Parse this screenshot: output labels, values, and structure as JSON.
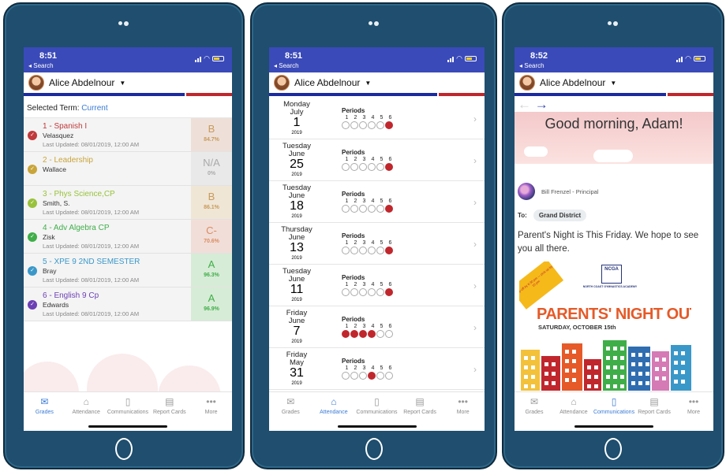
{
  "screens": [
    {
      "status_time": "8:51",
      "back_label": "◂ Search",
      "user_name": "Alice Abdelnour",
      "term_label": "Selected Term:",
      "term_value": "Current",
      "courses": [
        {
          "name": "1 - Spanish I",
          "teacher": "Velasquez",
          "updated": "Last Updated: 08/01/2019, 12:00 AM",
          "grade": "B",
          "pct": "84.7%",
          "accent": "#c0393b",
          "bg": "#eee0d9",
          "fg": "#c99a5a"
        },
        {
          "name": "2 - Leadership",
          "teacher": "Wallace",
          "updated": "",
          "grade": "N/A",
          "pct": "0%",
          "accent": "#c9a53a",
          "bg": "#e9e9e9",
          "fg": "#aaaaaa"
        },
        {
          "name": "3 - Phys Science,CP",
          "teacher": "Smith, S.",
          "updated": "Last Updated: 08/01/2019, 12:00 AM",
          "grade": "B",
          "pct": "86.1%",
          "accent": "#98c23a",
          "bg": "#efe6d6",
          "fg": "#c99a5a"
        },
        {
          "name": "4 - Adv Algebra CP",
          "teacher": "Zisk",
          "updated": "Last Updated: 08/01/2019, 12:00 AM",
          "grade": "C-",
          "pct": "70.6%",
          "accent": "#3fae49",
          "bg": "#f2ded8",
          "fg": "#d88c62"
        },
        {
          "name": "5 - XPE 9 2ND SEMESTER",
          "teacher": "Bray",
          "updated": "Last Updated: 08/01/2019, 12:00 AM",
          "grade": "A",
          "pct": "96.3%",
          "accent": "#3a98c9",
          "bg": "#d7ecd6",
          "fg": "#3fae49"
        },
        {
          "name": "6 - English 9 Cp",
          "teacher": "Edwards",
          "updated": "Last Updated: 08/01/2019, 12:00 AM",
          "grade": "A",
          "pct": "96.9%",
          "accent": "#6b3fb5",
          "bg": "#d7ecd6",
          "fg": "#3fae49"
        }
      ]
    },
    {
      "status_time": "8:51",
      "back_label": "◂ Search",
      "user_name": "Alice Abdelnour",
      "periods_label": "Periods",
      "period_numbers": [
        "1",
        "2",
        "3",
        "4",
        "5",
        "6"
      ],
      "days": [
        {
          "dow": "Monday",
          "month": "July",
          "day": "1",
          "year": "2019",
          "absent": [
            6
          ]
        },
        {
          "dow": "Tuesday",
          "month": "June",
          "day": "25",
          "year": "2019",
          "absent": [
            6
          ]
        },
        {
          "dow": "Tuesday",
          "month": "June",
          "day": "18",
          "year": "2019",
          "absent": [
            6
          ]
        },
        {
          "dow": "Thursday",
          "month": "June",
          "day": "13",
          "year": "2019",
          "absent": [
            6
          ]
        },
        {
          "dow": "Tuesday",
          "month": "June",
          "day": "11",
          "year": "2019",
          "absent": [
            6
          ]
        },
        {
          "dow": "Friday",
          "month": "June",
          "day": "7",
          "year": "2019",
          "absent": [
            1,
            2,
            3,
            4
          ]
        },
        {
          "dow": "Friday",
          "month": "May",
          "day": "31",
          "year": "2019",
          "absent": [
            4
          ]
        }
      ]
    },
    {
      "status_time": "8:52",
      "back_label": "◂ Search",
      "user_name": "Alice Abdelnour",
      "greeting": "Good morning, Adam!",
      "sender": "Bill Frenzel - Principal",
      "to_label": "To:",
      "recipient": "Grand District",
      "message": "Parent's Night is This Friday. We hope to see you all there.",
      "poster": {
        "logo_text": "NCGA",
        "logo_sub": "NORTH COAST GYMNASTICS ACADEMY",
        "ribbon": "Drop-off by 6:30 pm — pick up by 10 pm",
        "title": "PARENTS' NIGHT OUT",
        "date": "SATURDAY, OCTOBER 15th"
      }
    }
  ],
  "tabs": [
    {
      "label": "Grades",
      "icon": "grades-icon",
      "glyph": "✉"
    },
    {
      "label": "Attendance",
      "icon": "attendance-icon",
      "glyph": "⌂"
    },
    {
      "label": "Communications",
      "icon": "communications-icon",
      "glyph": "▯"
    },
    {
      "label": "Report Cards",
      "icon": "report-cards-icon",
      "glyph": "▤"
    },
    {
      "label": "More",
      "icon": "more-icon",
      "glyph": "•••"
    }
  ],
  "active_tab": [
    0,
    1,
    2
  ],
  "colors": {
    "device": "#1f4e6e",
    "statusbar": "#3a4ab8",
    "accent_blue": "#1b2aa0",
    "accent_red": "#c0272d",
    "link": "#3a7bd5"
  }
}
